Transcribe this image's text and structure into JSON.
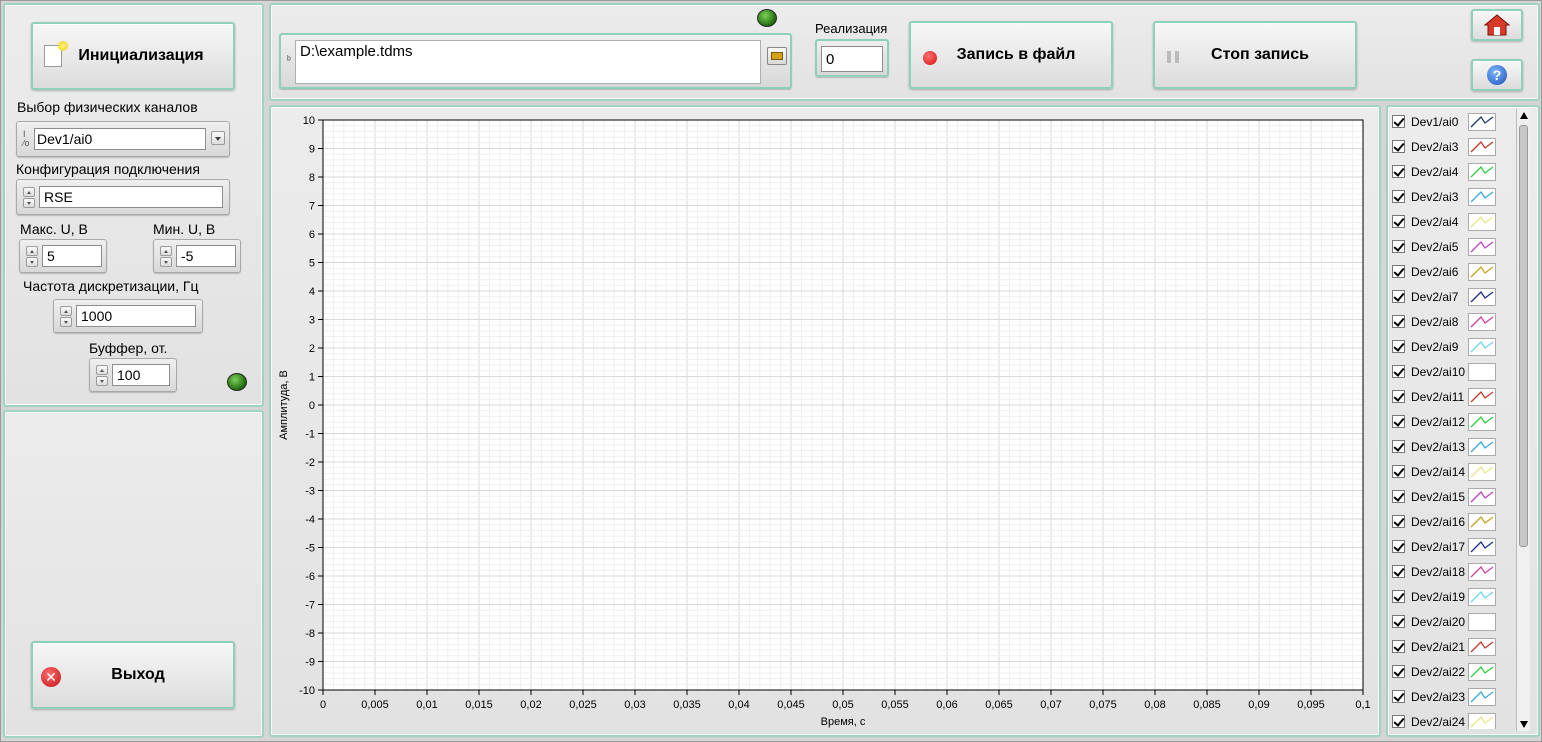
{
  "left": {
    "init_button_label": "Инициализация",
    "channels_label": "Выбор физических каналов",
    "channels_value": "Dev1/ai0",
    "connection_label": "Конфигурация подключения",
    "connection_value": "RSE",
    "max_u_label": "Макс. U, В",
    "max_u_value": "5",
    "min_u_label": "Мин. U, В",
    "min_u_value": "-5",
    "rate_label": "Частота дискретизации, Гц",
    "rate_value": "1000",
    "buffer_label": "Буффер, от.",
    "buffer_value": "100",
    "exit_button_label": "Выход"
  },
  "top": {
    "file_path": "D:\\example.tdms",
    "realization_label": "Реализация",
    "realization_value": "0",
    "record_button_label": "Запись в файл",
    "stop_button_label": "Стоп запись"
  },
  "icons": {
    "home": "home-icon",
    "help": "help-icon",
    "folder": "folder-open-icon",
    "record": "red-dot-icon",
    "stop": "pause-icon",
    "exit": "red-x-icon",
    "init": "new-document-icon"
  },
  "chart_data": {
    "type": "line",
    "xlabel": "Время, с",
    "ylabel": "Амплитуда, В",
    "xlim": [
      0,
      0.1
    ],
    "ylim": [
      -10,
      10
    ],
    "x_ticks": [
      "0",
      "0,005",
      "0,01",
      "0,015",
      "0,02",
      "0,025",
      "0,03",
      "0,035",
      "0,04",
      "0,045",
      "0,05",
      "0,055",
      "0,06",
      "0,065",
      "0,07",
      "0,075",
      "0,08",
      "0,085",
      "0,09",
      "0,095",
      "0,1"
    ],
    "y_ticks": [
      "10",
      "9",
      "8",
      "7",
      "6",
      "5",
      "4",
      "3",
      "2",
      "1",
      "0",
      "-1",
      "-2",
      "-3",
      "-4",
      "-5",
      "-6",
      "-7",
      "-8",
      "-9",
      "-10"
    ],
    "grid": true,
    "series": []
  },
  "legend": [
    {
      "name": "Dev1/ai0",
      "color": "#1e3a6e"
    },
    {
      "name": "Dev2/ai3",
      "color": "#c0392b"
    },
    {
      "name": "Dev2/ai4",
      "color": "#2ecc40"
    },
    {
      "name": "Dev2/ai3",
      "color": "#3aa8e0"
    },
    {
      "name": "Dev2/ai4",
      "color": "#e6e68a"
    },
    {
      "name": "Dev2/ai5",
      "color": "#c040c0"
    },
    {
      "name": "Dev2/ai6",
      "color": "#c8a020"
    },
    {
      "name": "Dev2/ai7",
      "color": "#1e2a8e"
    },
    {
      "name": "Dev2/ai8",
      "color": "#d040a0"
    },
    {
      "name": "Dev2/ai9",
      "color": "#70d8e8"
    },
    {
      "name": "Dev2/ai10",
      "color": "#ffffff"
    },
    {
      "name": "Dev2/ai11",
      "color": "#c0392b"
    },
    {
      "name": "Dev2/ai12",
      "color": "#2ecc40"
    },
    {
      "name": "Dev2/ai13",
      "color": "#3aa8e0"
    },
    {
      "name": "Dev2/ai14",
      "color": "#e6e68a"
    },
    {
      "name": "Dev2/ai15",
      "color": "#c040c0"
    },
    {
      "name": "Dev2/ai16",
      "color": "#c8a020"
    },
    {
      "name": "Dev2/ai17",
      "color": "#1e2a8e"
    },
    {
      "name": "Dev2/ai18",
      "color": "#d040a0"
    },
    {
      "name": "Dev2/ai19",
      "color": "#70d8e8"
    },
    {
      "name": "Dev2/ai20",
      "color": "#ffffff"
    },
    {
      "name": "Dev2/ai21",
      "color": "#c0392b"
    },
    {
      "name": "Dev2/ai22",
      "color": "#2ecc40"
    },
    {
      "name": "Dev2/ai23",
      "color": "#3aa8e0"
    },
    {
      "name": "Dev2/ai24",
      "color": "#e6e68a"
    }
  ]
}
